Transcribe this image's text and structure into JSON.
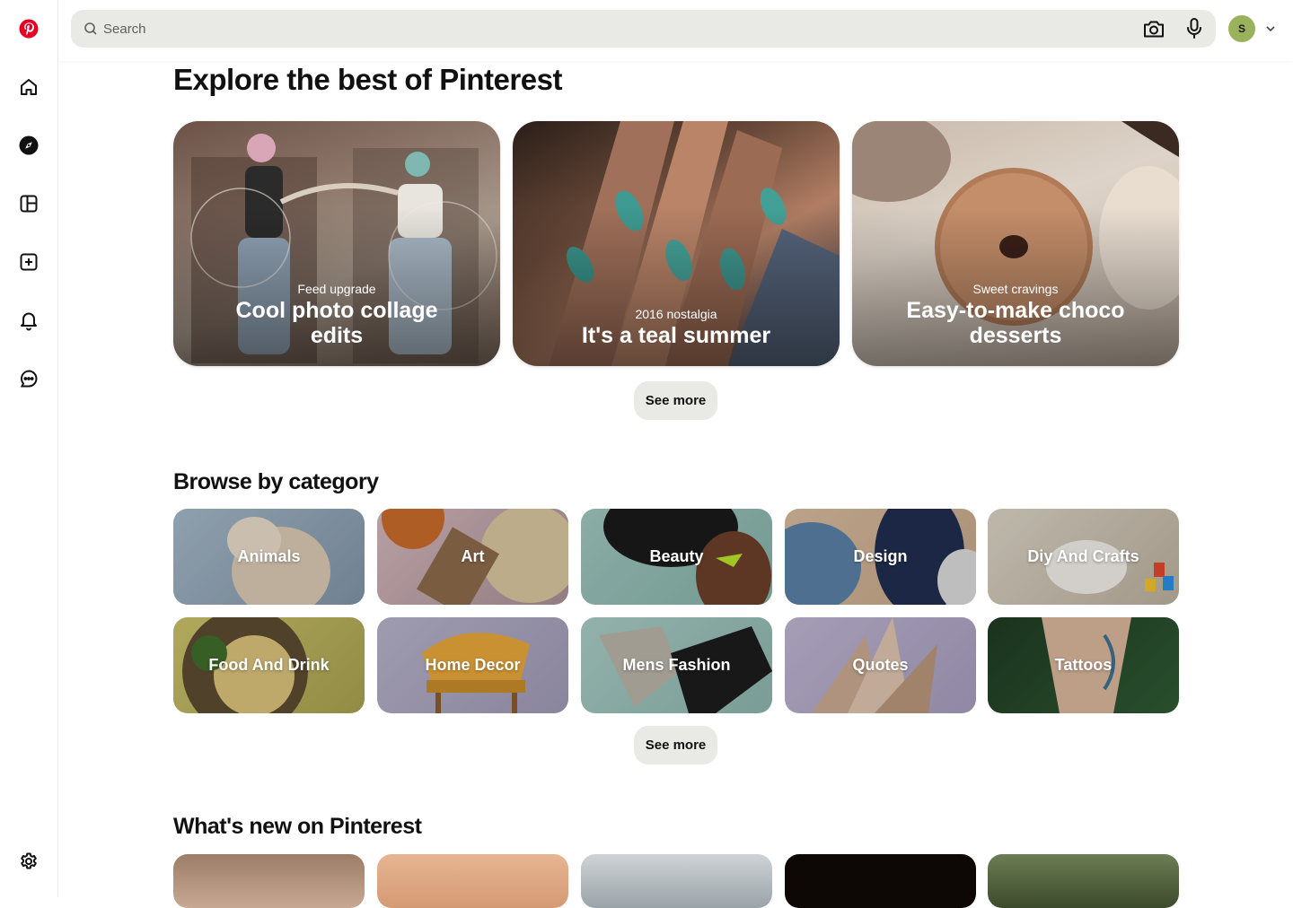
{
  "search": {
    "placeholder": "Search"
  },
  "user": {
    "initial": "S"
  },
  "sidebar": {
    "items": [
      {
        "name": "home"
      },
      {
        "name": "explore"
      },
      {
        "name": "boards"
      },
      {
        "name": "create"
      },
      {
        "name": "notifications"
      },
      {
        "name": "messages"
      }
    ],
    "settings": "settings"
  },
  "explore": {
    "title": "Explore the best of Pinterest",
    "cards": [
      {
        "subtitle": "Feed upgrade",
        "title": "Cool photo collage edits"
      },
      {
        "subtitle": "2016 nostalgia",
        "title": "It's a teal summer"
      },
      {
        "subtitle": "Sweet cravings",
        "title": "Easy-to-make choco desserts"
      }
    ],
    "see_more": "See more"
  },
  "browse": {
    "title": "Browse by category",
    "categories": [
      {
        "label": "Animals"
      },
      {
        "label": "Art"
      },
      {
        "label": "Beauty"
      },
      {
        "label": "Design"
      },
      {
        "label": "Diy And Crafts"
      },
      {
        "label": "Food And Drink"
      },
      {
        "label": "Home Decor"
      },
      {
        "label": "Mens Fashion"
      },
      {
        "label": "Quotes"
      },
      {
        "label": "Tattoos"
      }
    ],
    "see_more": "See more"
  },
  "whats_new": {
    "title": "What's new on Pinterest"
  },
  "colors": {
    "brand": "#e60023",
    "search_bg": "#e9e9e5",
    "avatar_bg": "#9bb25c"
  }
}
